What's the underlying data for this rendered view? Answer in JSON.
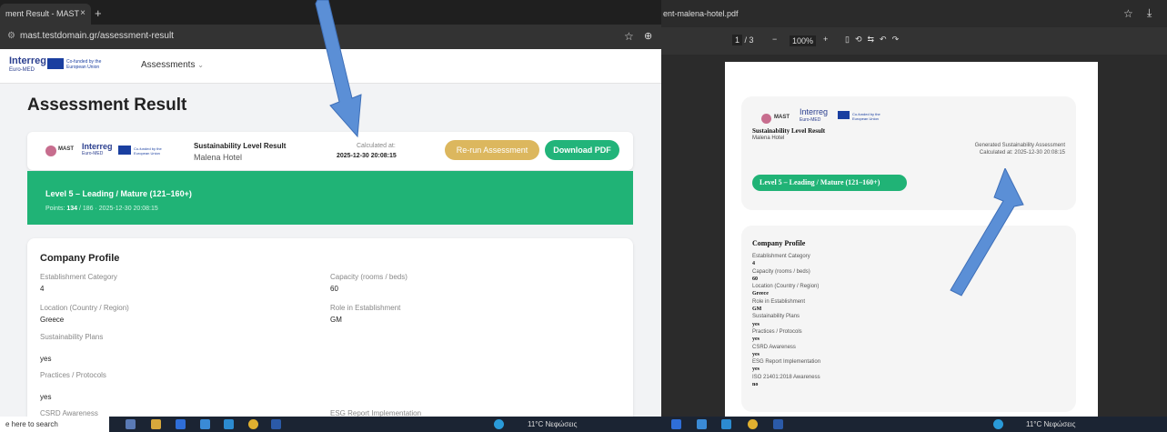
{
  "left_window": {
    "tab_title": "ment Result - MAST",
    "tab_close": "×",
    "tab_new": "+",
    "url": "mast.testdomain.gr/assessment-result",
    "site": {
      "logo_interreg": "Interreg",
      "logo_sub": "Euro-MED",
      "eu_text": "Co-funded by the European Union",
      "nav_assessments": "Assessments"
    },
    "page_title": "Assessment Result",
    "card": {
      "mast": "MAST",
      "slr_title": "Sustainability Level Result",
      "hotel": "Malena Hotel",
      "calc_label": "Calculated at:",
      "calc_date": "2025-12-30 20:08:15",
      "rerun": "Re-run Assessment",
      "download": "Download PDF"
    },
    "level": {
      "text": "Level 5 – Leading / Mature (121–160+)",
      "points_label": "Points:",
      "points_value": "134",
      "points_rest": "/ 186 · 2025-12-30 20:08:15"
    },
    "profile": {
      "title": "Company Profile",
      "est_label": "Establishment Category",
      "est_value": "4",
      "cap_label": "Capacity (rooms / beds)",
      "cap_value": "60",
      "loc_label": "Location (Country / Region)",
      "loc_value": "Greece",
      "role_label": "Role in Establishment",
      "role_value": "GM",
      "sus_label": "Sustainability Plans",
      "sus_value": "yes",
      "prac_label": "Practices / Protocols",
      "prac_value": "yes",
      "csrd_label": "CSRD Awareness",
      "esg_label": "ESG Report Implementation"
    }
  },
  "right_window": {
    "filename": "ent-malena-hotel.pdf",
    "page_current": "1",
    "page_total": "/ 3",
    "zoom": "100%",
    "pdf": {
      "mast": "MAST",
      "interreg": "Interreg",
      "interreg_sub": "Euro-MED",
      "eu_text": "Co-funded by the European Union",
      "slr_title": "Sustainability Level Result",
      "hotel": "Malena Hotel",
      "generated": "Generated Sustainability Assessment",
      "calculated": "Calculated at: 2025-12-30 20:08:15",
      "level": "Level 5 – Leading / Mature (121–160+)",
      "company_profile": "Company Profile",
      "rows": [
        {
          "label": "Establishment Category",
          "value": "4"
        },
        {
          "label": "Capacity (rooms / beds)",
          "value": "60"
        },
        {
          "label": "Location (Country / Region)",
          "value": "Greece"
        },
        {
          "label": "Role in Establishment",
          "value": "GM"
        },
        {
          "label": "Sustainability Plans",
          "value": "yes"
        },
        {
          "label": "Practices / Protocols",
          "value": "yes"
        },
        {
          "label": "CSRD Awareness",
          "value": "yes"
        },
        {
          "label": "ESG Report Implementation",
          "value": "yes"
        },
        {
          "label": "ISO 21401:2018 Awareness",
          "value": "no"
        }
      ]
    }
  },
  "taskbar": {
    "search": "e here to search",
    "weather_left": "11°C Νεφώσεις",
    "weather_right": "11°C Νεφώσεις"
  }
}
